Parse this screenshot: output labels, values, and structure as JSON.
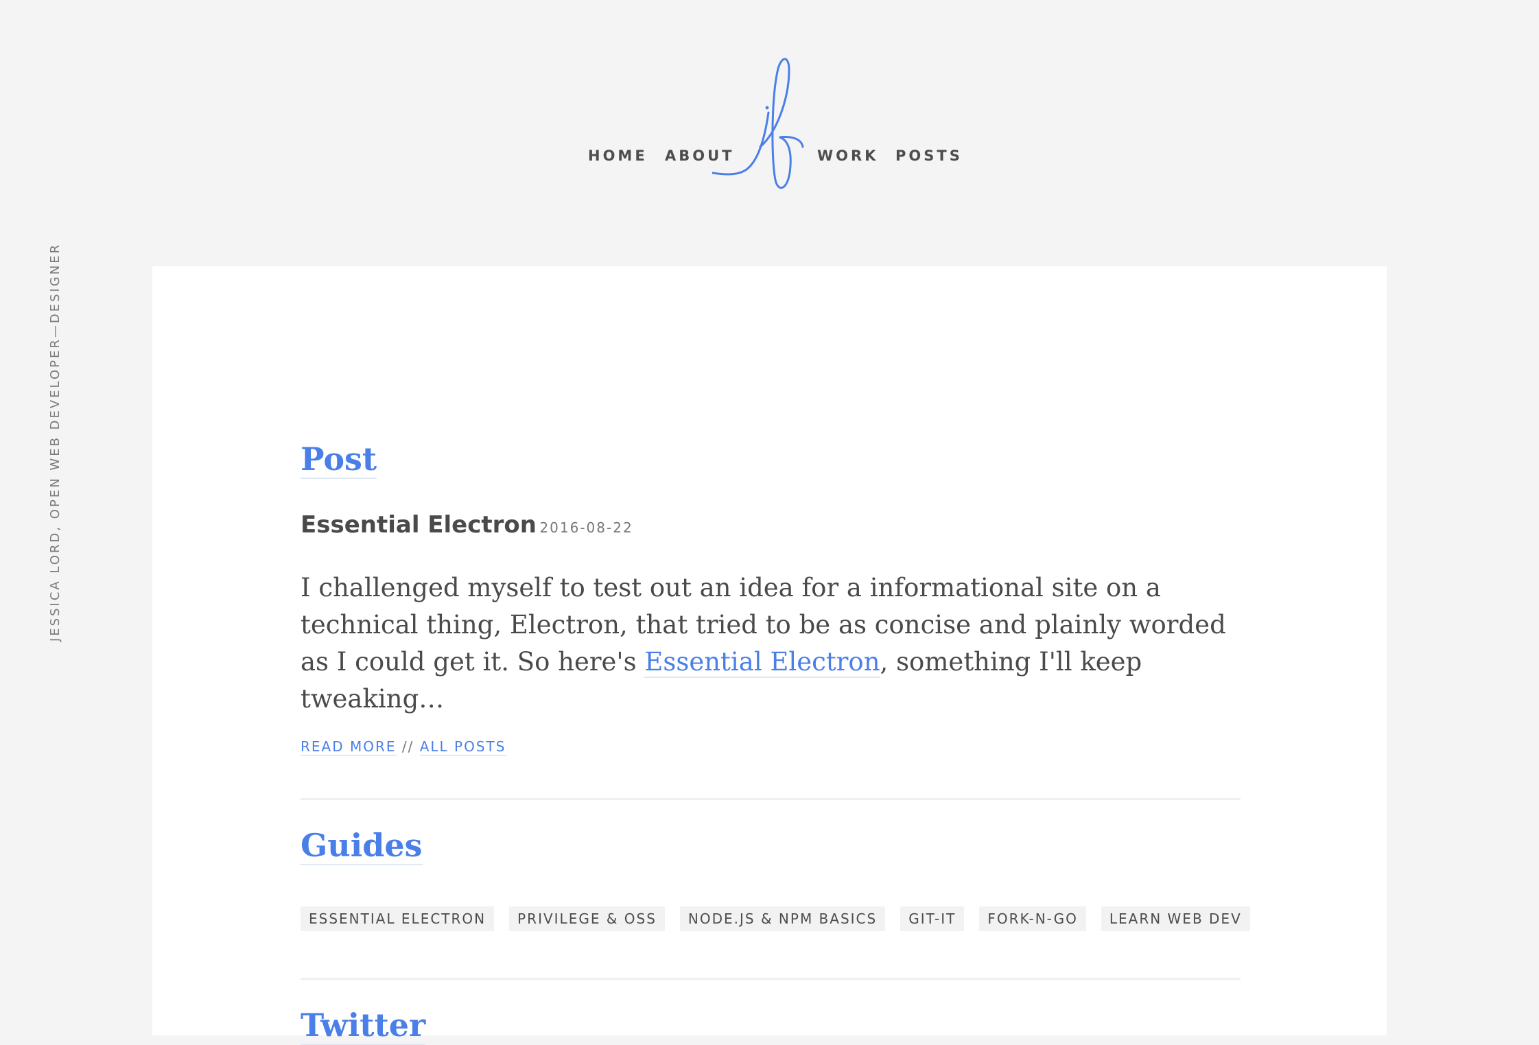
{
  "nav": {
    "items": [
      {
        "label": "HOME"
      },
      {
        "label": "ABOUT"
      },
      {
        "label": "WORK"
      },
      {
        "label": "POSTS"
      }
    ],
    "logo_icon": "jl-monogram-logo-icon"
  },
  "side_tagline": "JESSICA LORD, OPEN WEB DEVELOPER—DESIGNER",
  "post_section": {
    "heading": "Post",
    "post_title": "Essential Electron",
    "post_date": "2016-08-22",
    "excerpt_before": "I challenged myself to test out an idea for a informational site on a technical thing, Electron, that tried to be as concise and plainly worded as I could get it. So here's ",
    "excerpt_link": "Essential Electron",
    "excerpt_after": ", something I'll keep tweaking…",
    "read_more": "READ MORE",
    "separator": "//",
    "all_posts": "ALL POSTS"
  },
  "guides_section": {
    "heading": "Guides",
    "tags": [
      {
        "label": "ESSENTIAL ELECTRON"
      },
      {
        "label": "PRIVILEGE & OSS"
      },
      {
        "label": "NODE.JS & NPM BASICS"
      },
      {
        "label": "GIT-IT"
      },
      {
        "label": "FORK-N-GO"
      },
      {
        "label": "LEARN WEB DEV"
      }
    ]
  },
  "twitter_section": {
    "heading": "Twitter"
  },
  "colors": {
    "accent": "#4a7fe8",
    "background": "#f4f4f4",
    "card": "#ffffff",
    "text": "#4a4a4a"
  }
}
